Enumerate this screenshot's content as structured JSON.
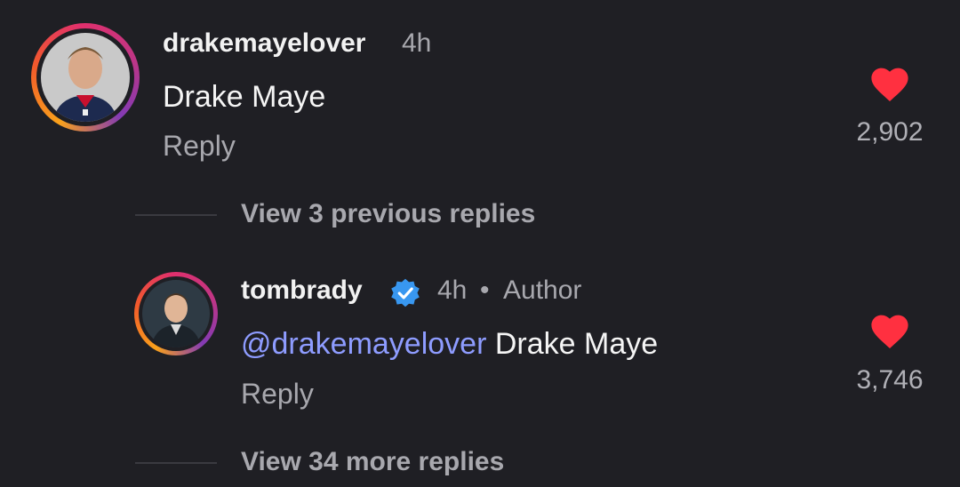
{
  "comments": [
    {
      "username": "drakemayelover",
      "time": "4h",
      "text": "Drake Maye",
      "reply_label": "Reply",
      "likes": "2,902"
    },
    {
      "username": "tombrady",
      "verified": true,
      "time": "4h",
      "separator": "•",
      "author_label": "Author",
      "mention": "@drakemayelover",
      "text": "Drake Maye",
      "reply_label": "Reply",
      "likes": "3,746"
    }
  ],
  "view_previous": "View 3 previous replies",
  "view_more": "View 34 more replies",
  "colors": {
    "background": "#1f1f24",
    "heart": "#ff3040",
    "mention": "#8e9cff",
    "verified": "#3897f0"
  },
  "icons": [
    "heart-icon",
    "verified-badge-icon"
  ]
}
